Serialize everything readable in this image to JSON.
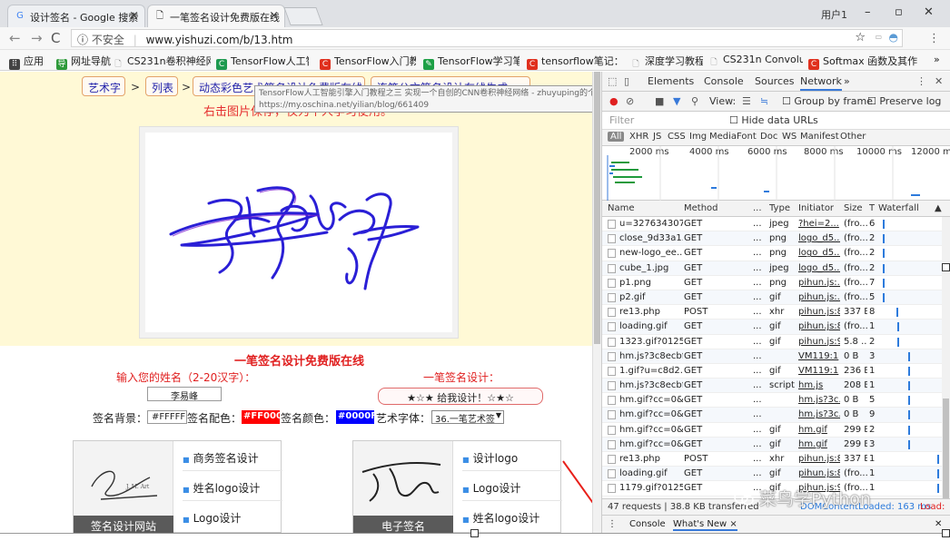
{
  "browser": {
    "tabs": [
      {
        "icon": "G",
        "title": "设计签名 - Google 搜索"
      },
      {
        "icon": "🗋",
        "title": "一笔签名设计免费版在线"
      }
    ],
    "user": "用户1",
    "window_controls": {
      "minimize": "–",
      "restore": "▫",
      "close": "✕"
    },
    "address": {
      "security": "不安全",
      "url": "www.yishuzi.com/b/13.htm"
    },
    "bookmarks": [
      {
        "icon": "⠿",
        "label": "应用",
        "color": "#444444"
      },
      {
        "icon": "导",
        "label": "网址导航",
        "color": "#2e9a3a"
      },
      {
        "icon": "🗋",
        "label": "CS231n卷积神经网络",
        "color": "#888888"
      },
      {
        "icon": "C",
        "label": "TensorFlow人工智能",
        "color": "#1e9a50"
      },
      {
        "icon": "C",
        "label": "TensorFlow入门教程",
        "color": "#e0301e"
      },
      {
        "icon": "✎",
        "label": "TensorFlow学习笔记",
        "color": "#1ea046"
      },
      {
        "icon": "C",
        "label": "tensorflow笔记：多",
        "color": "#e0301e"
      },
      {
        "icon": "🗋",
        "label": "深度学习教程",
        "color": "#888888"
      },
      {
        "icon": "🗋",
        "label": "CS231n Convolution",
        "color": "#888888"
      },
      {
        "icon": "C",
        "label": "Softmax 函数及其作",
        "color": "#e0301e"
      }
    ],
    "bookmarks_more": "»"
  },
  "page": {
    "breadcrumb": [
      "艺术字",
      "列表",
      "动态彩色艺术签名设计免费版在线",
      "连笔公文签名设计在线生成"
    ],
    "crumb_sep": ">",
    "hint": "右击图片保存，仅为个人学习使用。",
    "tooltip_line1": "TensorFlow人工智能引擎入门教程之三 实现一个自创的CNN卷积神经网络 - zhuyuping的个人空间",
    "tooltip_line2": "https://my.oschina.net/yilian/blog/661409",
    "form_title": "一笔签名设计免费版在线",
    "name_label": "输入您的姓名（2-20汉字）：",
    "name_value": "李易峰",
    "design_label": "一笔签名设计：",
    "design_button": "★☆★ 给我设计！☆★☆",
    "bg_label": "签名背景：",
    "bg_value": "#FFFFFF",
    "accent_label": "签名配色：",
    "accent_value": "#FF0000",
    "color_label": "签名颜色：",
    "color_value": "#0000FF",
    "font_label": "艺术字体：",
    "font_value": "36.一笔艺术签",
    "card1": {
      "caption": "签名设计网站",
      "items": [
        "商务签名设计",
        "姓名logo设计",
        "Logo设计"
      ]
    },
    "card2": {
      "caption": "电子签名",
      "items": [
        "设计logo",
        "Logo设计",
        "姓名logo设计"
      ]
    }
  },
  "devtools": {
    "tabs": [
      "Elements",
      "Console",
      "Sources",
      "Network"
    ],
    "active_tab": "Network",
    "more": "»",
    "toolbar": {
      "view_label": "View:",
      "group_by_frame": "Group by frame",
      "preserve_log": "Preserve log"
    },
    "filter_placeholder": "Filter",
    "hide_data_urls": "Hide data URLs",
    "types": [
      "All",
      "XHR",
      "JS",
      "CSS",
      "Img",
      "Media",
      "Font",
      "Doc",
      "WS",
      "Manifest",
      "Other"
    ],
    "timeline_labels": [
      "2000 ms",
      "4000 ms",
      "6000 ms",
      "8000 ms",
      "10000 ms",
      "12000 ms"
    ],
    "columns": [
      "Name",
      "Method",
      "...",
      "Type",
      "Initiator",
      "Size",
      "T",
      "Waterfall"
    ],
    "rows": [
      {
        "name": "u=327634307...",
        "method": "GET",
        "type": "jpeg",
        "initiator": "?hei=2...",
        "size": "(fro...",
        "t": "6",
        "wf": 0.04
      },
      {
        "name": "close_9d33a1...",
        "method": "GET",
        "type": "png",
        "initiator": "logo_d5...",
        "size": "(fro...",
        "t": "2",
        "wf": 0.04
      },
      {
        "name": "new-logo_ee...",
        "method": "GET",
        "type": "png",
        "initiator": "logo_d5...",
        "size": "(fro...",
        "t": "2",
        "wf": 0.04
      },
      {
        "name": "cube_1.jpg",
        "method": "GET",
        "type": "jpeg",
        "initiator": "logo_d5...",
        "size": "(fro...",
        "t": "2",
        "wf": 0.04
      },
      {
        "name": "p1.png",
        "method": "GET",
        "type": "png",
        "initiator": "pihun.js:...",
        "size": "(fro...",
        "t": "7",
        "wf": 0.04
      },
      {
        "name": "p2.gif",
        "method": "GET",
        "type": "gif",
        "initiator": "pihun.js:...",
        "size": "(fro...",
        "t": "5",
        "wf": 0.04
      },
      {
        "name": "re13.php",
        "method": "POST",
        "type": "xhr",
        "initiator": "pihun.js:8",
        "size": "337 B",
        "t": "8",
        "wf": 0.28
      },
      {
        "name": "loading.gif",
        "method": "GET",
        "type": "gif",
        "initiator": "pihun.js:8",
        "size": "(fro...",
        "t": "1",
        "wf": 0.3
      },
      {
        "name": "1323.gif?0125...",
        "method": "GET",
        "type": "gif",
        "initiator": "pihun.js:9",
        "size": "5.8 ...",
        "t": "2",
        "wf": 0.3
      },
      {
        "name": "hm.js?3c8ecbf...",
        "method": "GET",
        "type": "",
        "initiator": "VM119:1",
        "size": "0 B",
        "t": "3",
        "wf": 0.48
      },
      {
        "name": "1.gif?u=c8d2...",
        "method": "GET",
        "type": "gif",
        "initiator": "VM119:1",
        "size": "236 B",
        "t": "1",
        "wf": 0.48
      },
      {
        "name": "hm.js?3c8ecbf...",
        "method": "GET",
        "type": "script",
        "initiator": "hm.js",
        "size": "208 B",
        "t": "1",
        "wf": 0.48
      },
      {
        "name": "hm.gif?cc=0&...",
        "method": "GET",
        "type": "",
        "initiator": "hm.js?3c...",
        "size": "0 B",
        "t": "5",
        "wf": 0.48
      },
      {
        "name": "hm.gif?cc=0&...",
        "method": "GET",
        "type": "",
        "initiator": "hm.js?3c...",
        "size": "0 B",
        "t": "9",
        "wf": 0.48
      },
      {
        "name": "hm.gif?cc=0&...",
        "method": "GET",
        "type": "gif",
        "initiator": "hm.gif",
        "size": "299 B",
        "t": "2",
        "wf": 0.48
      },
      {
        "name": "hm.gif?cc=0&...",
        "method": "GET",
        "type": "gif",
        "initiator": "hm.gif",
        "size": "299 B",
        "t": "3",
        "wf": 0.48
      },
      {
        "name": "re13.php",
        "method": "POST",
        "type": "xhr",
        "initiator": "pihun.js:8",
        "size": "337 B",
        "t": "1",
        "wf": 0.98
      },
      {
        "name": "loading.gif",
        "method": "GET",
        "type": "gif",
        "initiator": "pihun.js:8",
        "size": "(fro...",
        "t": "1",
        "wf": 0.98
      },
      {
        "name": "1179.gif?0125...",
        "method": "GET",
        "type": "gif",
        "initiator": "pihun.js:9",
        "size": "(fro...",
        "t": "1",
        "wf": 0.98
      }
    ],
    "status_requests": "47 requests | 38.8 KB transferred",
    "status_dom": "DOMContentLoaded: 163 ms",
    "status_load": "Load:",
    "drawer_tabs": [
      "Console",
      "What's New ×"
    ]
  },
  "watermark": "菜鸟学Python",
  "colors": {
    "accent_red": "#e02020",
    "link_blue": "#2222aa",
    "devtools_active": "#3879d9"
  }
}
